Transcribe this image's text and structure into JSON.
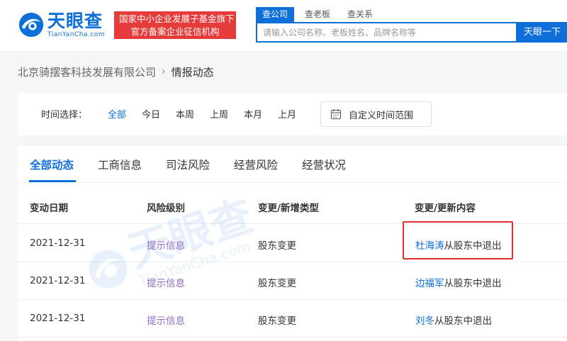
{
  "header": {
    "logo_cn": "天眼查",
    "logo_en": "TianYanCha.com",
    "badge_line1": "国家中小企业发展子基金旗下",
    "badge_line2": "官方备案企业征信机构",
    "search_tabs": [
      {
        "label": "查公司",
        "active": true
      },
      {
        "label": "查老板",
        "active": false
      },
      {
        "label": "查关系",
        "active": false
      }
    ],
    "search_placeholder": "请输入公司名称、老板姓名、品牌名称等",
    "search_value": "",
    "search_button": "天眼一下"
  },
  "breadcrumb": {
    "company": "北京骑摆客科技发展有限公司",
    "separator": "›",
    "current": "情报动态"
  },
  "time_filter": {
    "label": "时间选择：",
    "options": [
      "全部",
      "今日",
      "本周",
      "上周",
      "本月",
      "上月"
    ],
    "active": "全部",
    "custom_range": "自定义时间范围"
  },
  "tabs": [
    "全部动态",
    "工商信息",
    "司法风险",
    "经营风险",
    "经营状况"
  ],
  "active_tab": "全部动态",
  "table": {
    "headers": [
      "变动日期",
      "风险级别",
      "变更/新增类型",
      "变更/更新内容"
    ],
    "rows": [
      {
        "date": "2021-12-31",
        "risk": "提示信息",
        "type": "股东变更",
        "name": "杜海涛",
        "suffix": "从股东中退出"
      },
      {
        "date": "2021-12-31",
        "risk": "提示信息",
        "type": "股东变更",
        "name": "边福军",
        "suffix": "从股东中退出"
      },
      {
        "date": "2021-12-31",
        "risk": "提示信息",
        "type": "股东变更",
        "name": "刘冬",
        "suffix": "从股东中退出"
      }
    ]
  },
  "watermark": {
    "cn": "天眼查",
    "en": "TianYanCha.com"
  },
  "colors": {
    "brand": "#0e6fd8",
    "badge": "#e63b3b",
    "risk": "#8e6bbf",
    "highlight": "#e42f2f"
  }
}
